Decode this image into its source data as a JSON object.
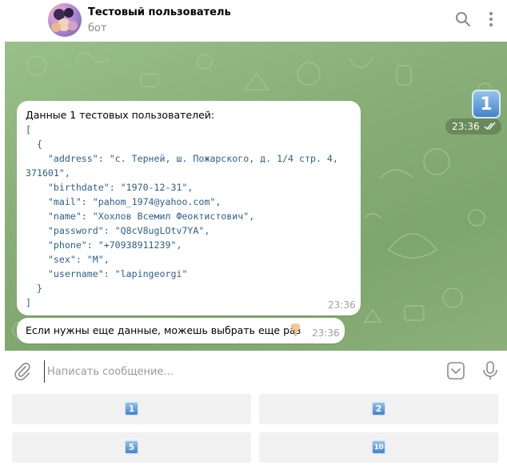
{
  "header": {
    "chat_name": "Тестовый пользователь",
    "status": "бот",
    "icons": [
      "search-icon",
      "more-vertical-icon"
    ]
  },
  "sent_message": {
    "keycap": "1",
    "time": "23:36",
    "read": true
  },
  "bot_message_1": {
    "title": "Данные 1 тестовых пользователей:",
    "code": "[\n  {\n    \"address\": \"с. Терней, ш. Пожарского, д. 1/4 стр. 4,\n371601\",\n    \"birthdate\": \"1970-12-31\",\n    \"mail\": \"pahom_1974@yahoo.com\",\n    \"name\": \"Хохлов Всемил Феоктистович\",\n    \"password\": \"Q8cV8ugLOtv7YA\",\n    \"phone\": \"+70938911239\",\n    \"sex\": \"М\",\n    \"username\": \"lapingeorgi\"\n  }\n]",
    "time": "23:36"
  },
  "bot_message_2": {
    "text": "Если нужны еще данные, можешь выбрать еще раз",
    "emoji": "pointing-down-hand",
    "time": "23:36"
  },
  "input": {
    "placeholder": "Написать сообщение...",
    "value": ""
  },
  "keyboard": {
    "buttons": [
      {
        "label": "1"
      },
      {
        "label": "2"
      },
      {
        "label": "5"
      },
      {
        "label": "10"
      }
    ]
  },
  "colors": {
    "chat_bg": "#8fb07c",
    "keycap": "#3f7fc7",
    "code_text": "#2f5f8a"
  }
}
